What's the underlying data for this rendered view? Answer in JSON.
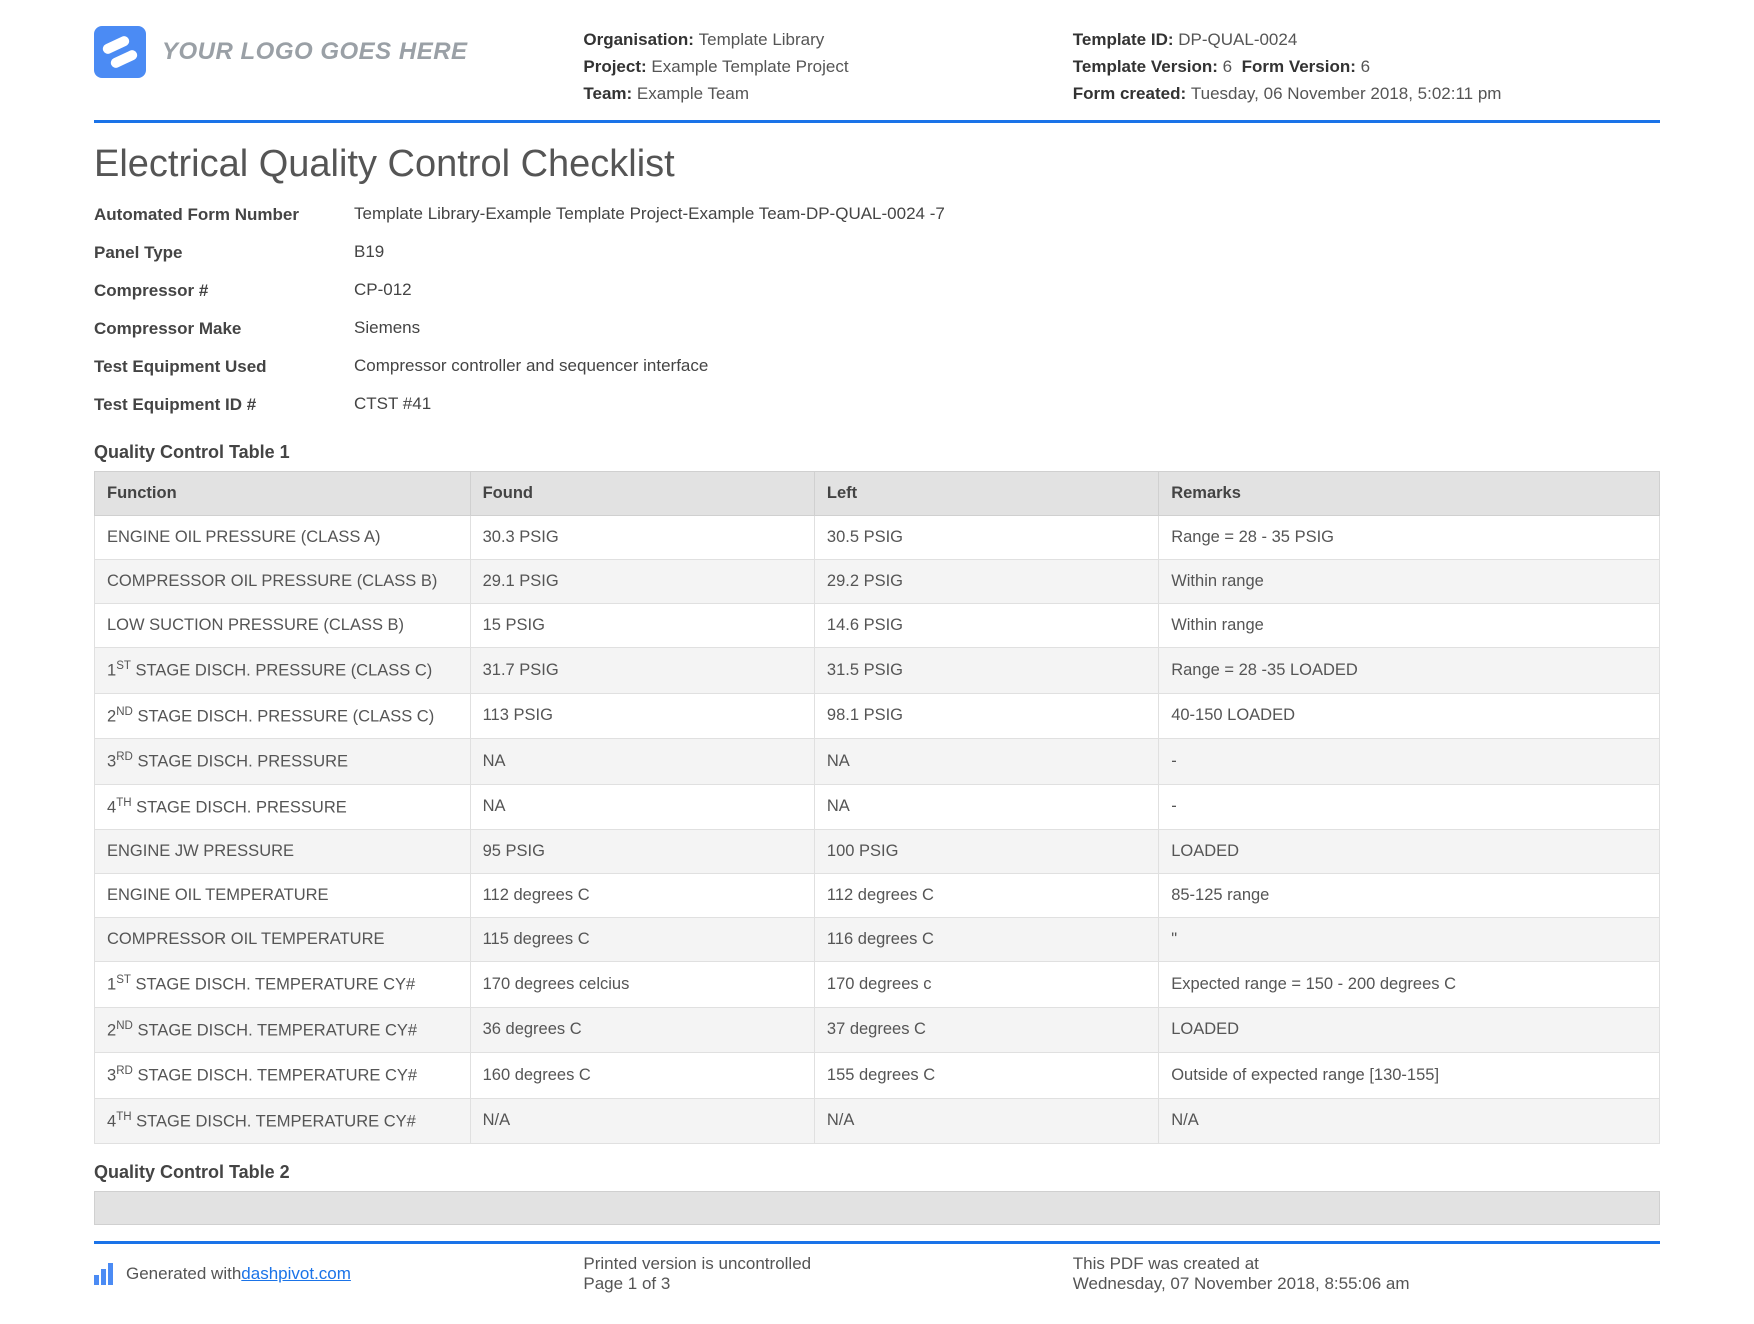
{
  "header": {
    "logo_text": "YOUR LOGO GOES HERE",
    "org_label": "Organisation:",
    "org": "Template Library",
    "project_label": "Project:",
    "project": "Example Template Project",
    "team_label": "Team:",
    "team": "Example Team",
    "template_id_label": "Template ID:",
    "template_id": "DP-QUAL-0024",
    "template_version_label": "Template Version:",
    "template_version": "6",
    "form_version_label": "Form Version:",
    "form_version": "6",
    "form_created_label": "Form created:",
    "form_created": "Tuesday, 06 November 2018, 5:02:11 pm"
  },
  "title": "Electrical Quality Control Checklist",
  "meta": [
    {
      "label": "Automated Form Number",
      "value": "Template Library-Example Template Project-Example Team-DP-QUAL-0024   -7"
    },
    {
      "label": "Panel Type",
      "value": "B19"
    },
    {
      "label": "Compressor #",
      "value": "CP-012"
    },
    {
      "label": "Compressor Make",
      "value": "Siemens"
    },
    {
      "label": "Test Equipment Used",
      "value": "Compressor controller and sequencer interface"
    },
    {
      "label": "Test Equipment ID #",
      "value": "CTST #41"
    }
  ],
  "qc1": {
    "heading": "Quality Control Table 1",
    "cols": [
      "Function",
      "Found",
      "Left",
      "Remarks"
    ],
    "rows": [
      {
        "func": "ENGINE OIL PRESSURE (CLASS A)",
        "sup": "",
        "found": "30.3 PSIG",
        "left": "30.5 PSIG",
        "remarks": "Range = 28 - 35 PSIG"
      },
      {
        "func": "COMPRESSOR OIL PRESSURE (CLASS B)",
        "sup": "",
        "found": "29.1 PSIG",
        "left": "29.2 PSIG",
        "remarks": "Within range"
      },
      {
        "func": "LOW SUCTION PRESSURE (CLASS B)",
        "sup": "",
        "found": "15 PSIG",
        "left": "14.6 PSIG",
        "remarks": "Within range"
      },
      {
        "func": " STAGE DISCH. PRESSURE (CLASS C)",
        "sup": "1ST",
        "found": "31.7 PSIG",
        "left": "31.5 PSIG",
        "remarks": "Range = 28 -35 LOADED"
      },
      {
        "func": " STAGE DISCH. PRESSURE (CLASS C)",
        "sup": "2ND",
        "found": "113 PSIG",
        "left": "98.1 PSIG",
        "remarks": "40-150 LOADED"
      },
      {
        "func": " STAGE DISCH. PRESSURE",
        "sup": "3RD",
        "found": "NA",
        "left": "NA",
        "remarks": "-"
      },
      {
        "func": " STAGE DISCH. PRESSURE",
        "sup": "4TH",
        "found": "NA",
        "left": "NA",
        "remarks": "-"
      },
      {
        "func": "ENGINE JW PRESSURE",
        "sup": "",
        "found": "95 PSIG",
        "left": "100 PSIG",
        "remarks": "LOADED"
      },
      {
        "func": "ENGINE OIL TEMPERATURE",
        "sup": "",
        "found": "112 degrees C",
        "left": "112 degrees C",
        "remarks": "85-125 range"
      },
      {
        "func": "COMPRESSOR OIL TEMPERATURE",
        "sup": "",
        "found": "115 degrees C",
        "left": "116 degrees C",
        "remarks": "\""
      },
      {
        "func": " STAGE DISCH. TEMPERATURE CY#",
        "sup": "1ST",
        "found": "170 degrees celcius",
        "left": "170 degrees c",
        "remarks": "Expected range = 150 - 200 degrees C"
      },
      {
        "func": " STAGE DISCH. TEMPERATURE CY#",
        "sup": "2ND",
        "found": "36 degrees C",
        "left": "37 degrees C",
        "remarks": "LOADED"
      },
      {
        "func": " STAGE DISCH. TEMPERATURE CY#",
        "sup": "3RD",
        "found": "160 degrees C",
        "left": "155 degrees C",
        "remarks": "Outside of expected range [130-155]"
      },
      {
        "func": " STAGE DISCH. TEMPERATURE CY#",
        "sup": "4TH",
        "found": "N/A",
        "left": "N/A",
        "remarks": "N/A"
      }
    ]
  },
  "qc2": {
    "heading": "Quality Control Table 2"
  },
  "footer": {
    "gen_prefix": "Generated with ",
    "gen_link": "dashpivot.com",
    "uncontrolled": "Printed version is uncontrolled",
    "page": "Page 1 of 3",
    "created_label": "This PDF was created at",
    "created": "Wednesday, 07 November 2018, 8:55:06 am"
  }
}
